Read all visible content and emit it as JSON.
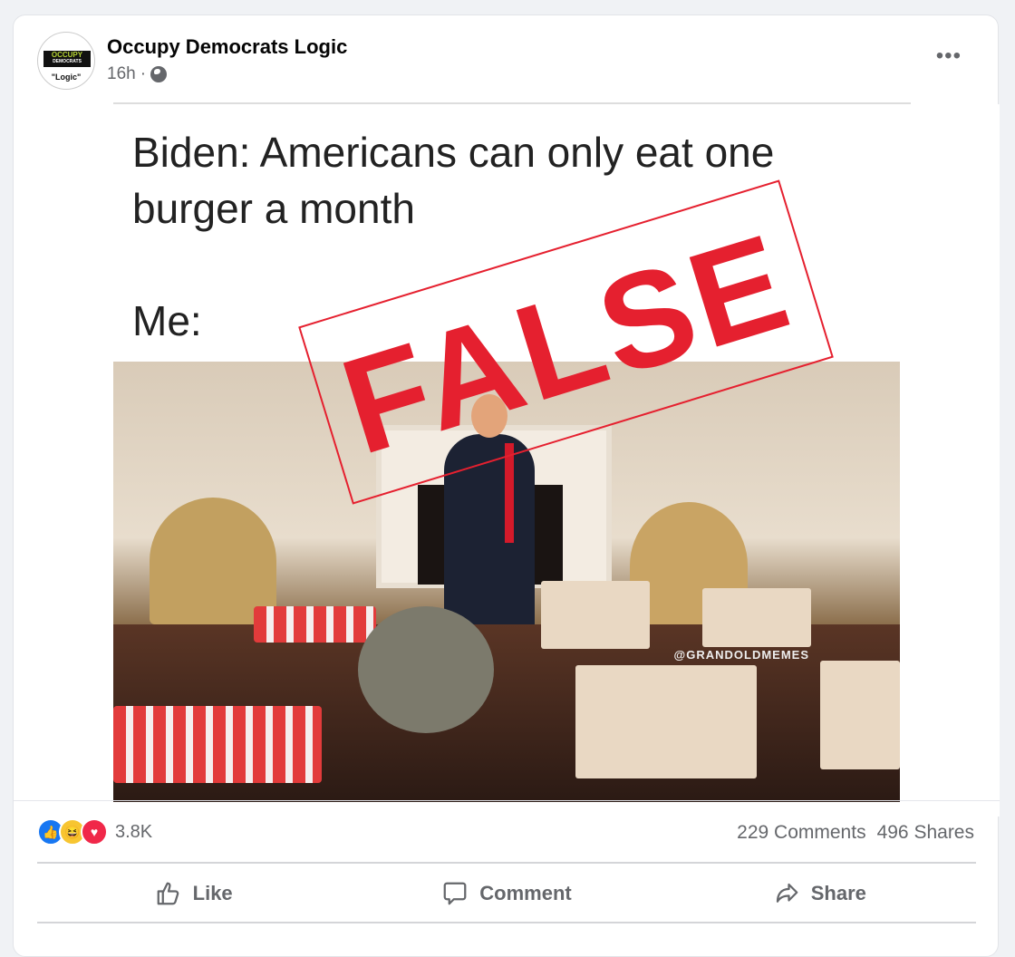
{
  "post": {
    "author": "Occupy Democrats Logic",
    "avatar_text": {
      "line1": "OCCUPY",
      "line2": "DEMOCRATS",
      "line3": "\"Logic\""
    },
    "time": "16h",
    "separator": "·",
    "privacy_icon": "globe-icon",
    "more_icon": "•••"
  },
  "meme": {
    "line1": "Biden: Americans can only eat one",
    "line2": "burger a month",
    "me": "Me:",
    "stamp": "FALSE",
    "watermark": "@GRANDOLDMEMES",
    "stamp_color": "#e5202f"
  },
  "engagement": {
    "reactions": [
      "like",
      "haha",
      "love"
    ],
    "reaction_count": "3.8K",
    "comments": "229 Comments",
    "shares": "496 Shares"
  },
  "actions": {
    "like": "Like",
    "comment": "Comment",
    "share": "Share"
  }
}
